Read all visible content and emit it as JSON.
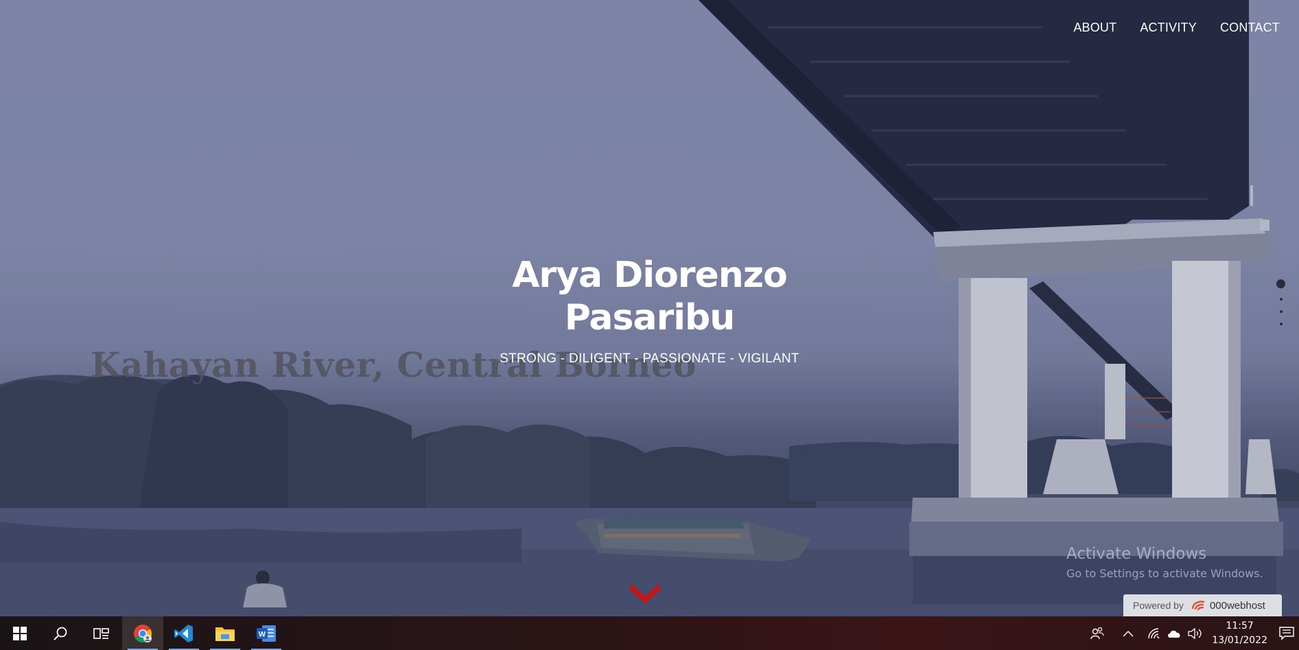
{
  "nav": {
    "items": [
      {
        "label": "ABOUT"
      },
      {
        "label": "ACTIVITY"
      },
      {
        "label": "CONTACT"
      }
    ]
  },
  "hero": {
    "name_line1": "Arya Diorenzo",
    "name_line2": "Pasaribu",
    "tagline": "STRONG - DILIGENT - PASSIONATE - VIGILANT",
    "location": "Kahayan River, Central Borneo"
  },
  "slider": {
    "total": 4,
    "active": 1
  },
  "watermark": {
    "line1": "Activate Windows",
    "line2": "Go to Settings to activate Windows."
  },
  "badge": {
    "label": "Powered by",
    "brand": "000webhost"
  },
  "taskbar": {
    "apps": [
      {
        "icon": "windows-start-icon"
      },
      {
        "icon": "search-icon"
      },
      {
        "icon": "task-view-icon"
      },
      {
        "icon": "chrome-icon",
        "active": true
      },
      {
        "icon": "vscode-icon"
      },
      {
        "icon": "file-explorer-icon"
      },
      {
        "icon": "word-icon"
      }
    ],
    "time": "11:57",
    "date": "13/01/2022"
  },
  "colors": {
    "accent_chevron": "#c0171b",
    "sky": "#8a91b4"
  }
}
